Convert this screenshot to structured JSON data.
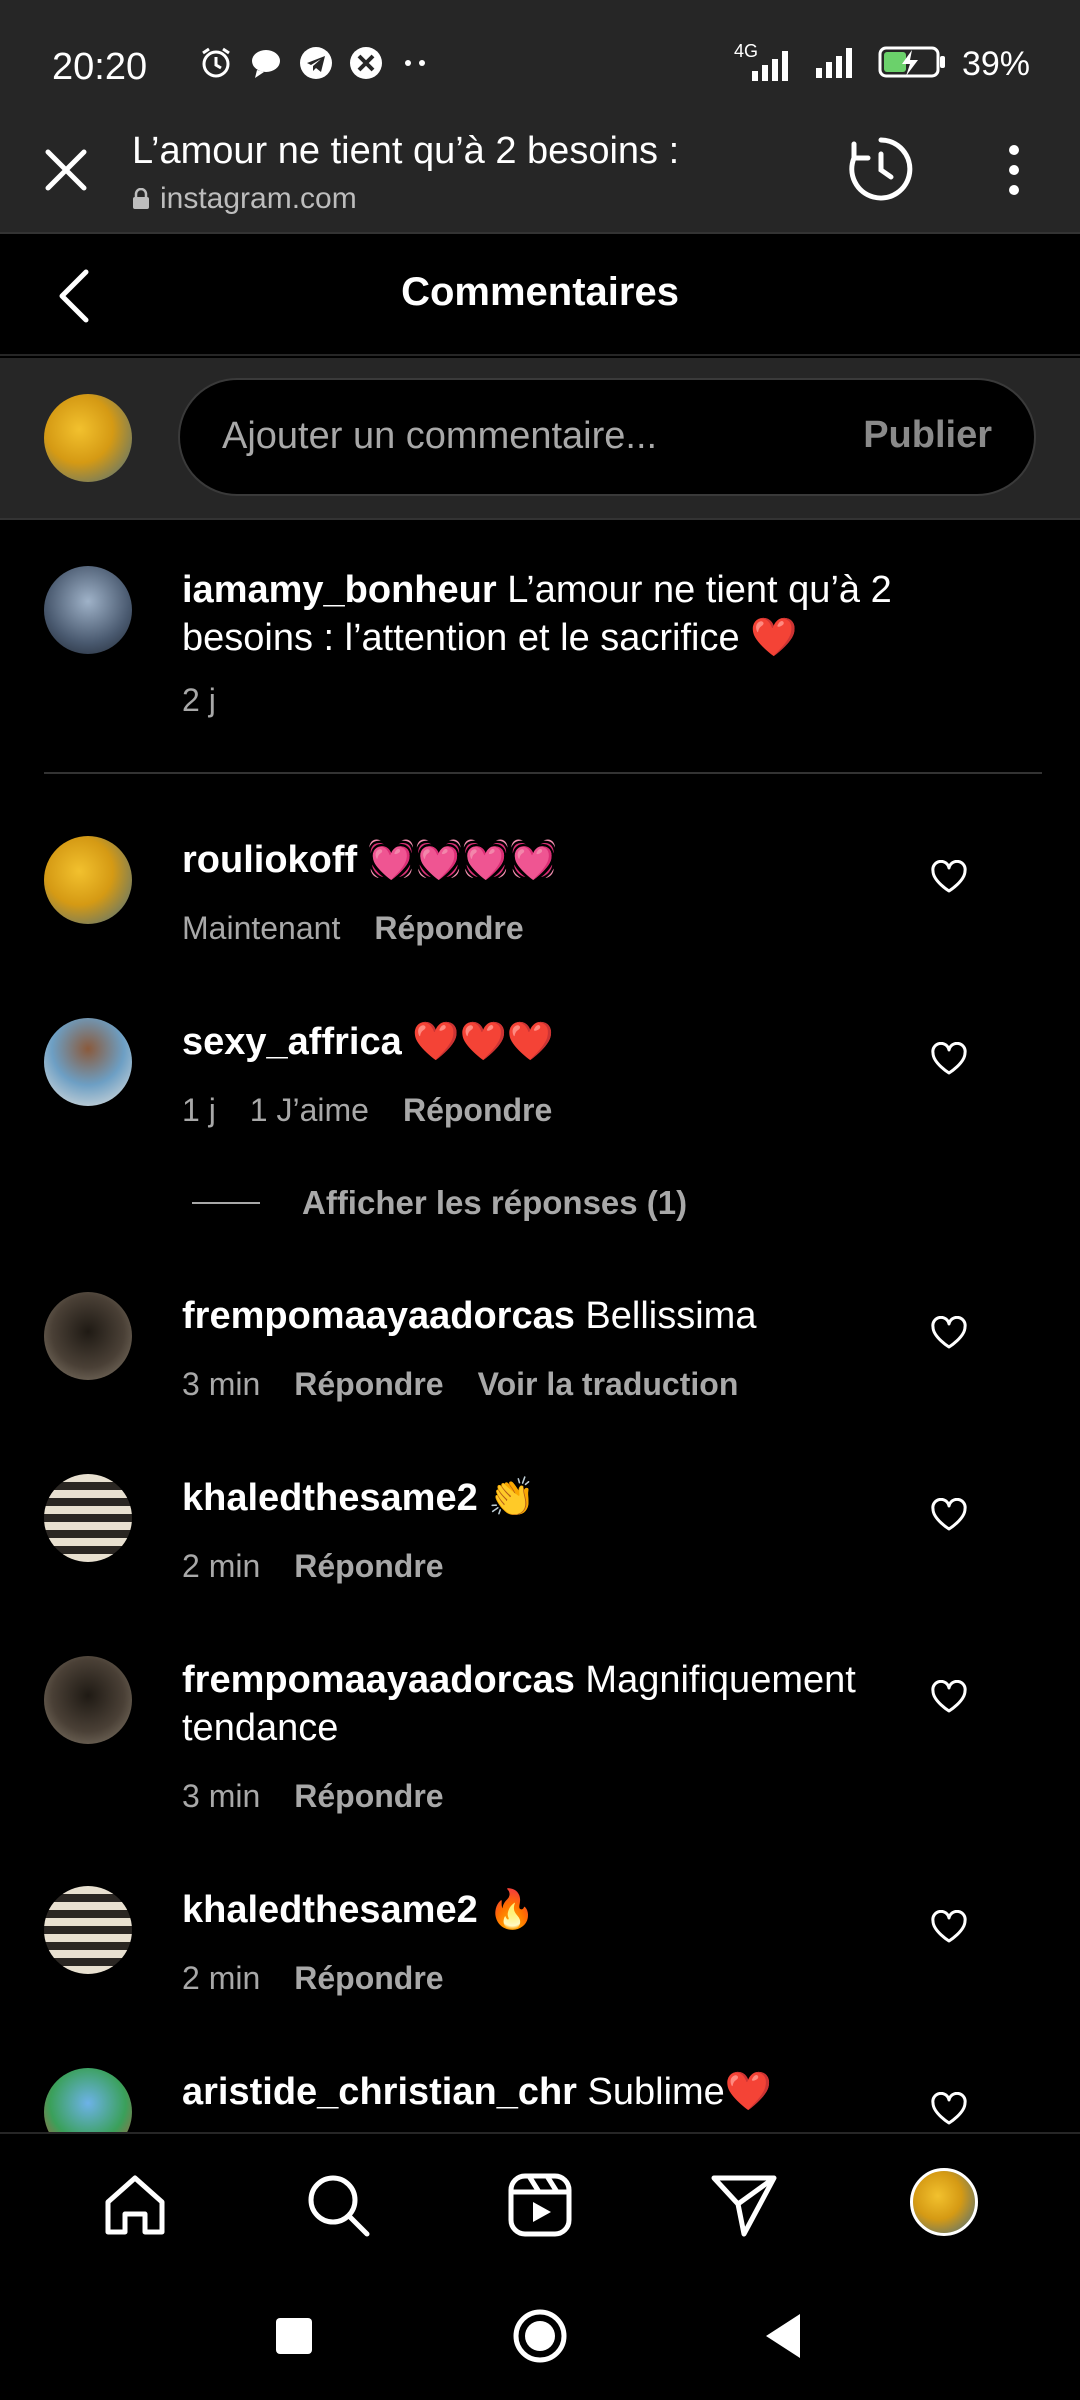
{
  "status_bar": {
    "time": "20:20",
    "network": "4G",
    "battery": "39%"
  },
  "browser": {
    "title": "L’amour ne tient qu’à 2 besoins :",
    "url": "instagram.com"
  },
  "header": {
    "title": "Commentaires"
  },
  "composer": {
    "placeholder": "Ajouter un commentaire...",
    "publish_label": "Publier"
  },
  "caption": {
    "username": "iamamy_bonheur",
    "text_line1": "L’amour ne tient qu’à 2",
    "text_line2": "besoins : l’attention et le sacrifice ❤️",
    "time": "2 j"
  },
  "comments": [
    {
      "username": "rouliokoff",
      "text": "💓💓💓💓",
      "time": "Maintenant",
      "likes": "",
      "reply": "Répondre",
      "extra": ""
    },
    {
      "username": "sexy_affrica",
      "text": "❤️❤️❤️",
      "time": "1 j",
      "likes": "1 J’aime",
      "reply": "Répondre",
      "extra": ""
    },
    {
      "username": "frempomaayaadorcas",
      "text": "Bellissima",
      "time": "3 min",
      "likes": "",
      "reply": "Répondre",
      "extra": "Voir la traduction"
    },
    {
      "username": "khaledthesame2",
      "text": "👏",
      "time": "2 min",
      "likes": "",
      "reply": "Répondre",
      "extra": ""
    },
    {
      "username": "frempomaayaadorcas",
      "text": "Magnifiquement",
      "text2": "tendance",
      "time": "3 min",
      "likes": "",
      "reply": "Répondre",
      "extra": ""
    },
    {
      "username": "khaledthesame2",
      "text": "🔥",
      "time": "2 min",
      "likes": "",
      "reply": "Répondre",
      "extra": ""
    },
    {
      "username": "aristide_christian_chr",
      "text": "Sublime❤️",
      "time": "",
      "likes": "",
      "reply": "",
      "extra": ""
    }
  ],
  "view_replies": "Afficher les réponses (1)",
  "icons": {
    "close": "close-icon",
    "history": "history-icon",
    "more": "more-icon",
    "back": "back-icon",
    "heart": "heart-icon",
    "home": "home-icon",
    "search": "search-icon",
    "reels": "reels-icon",
    "direct": "direct-icon"
  }
}
